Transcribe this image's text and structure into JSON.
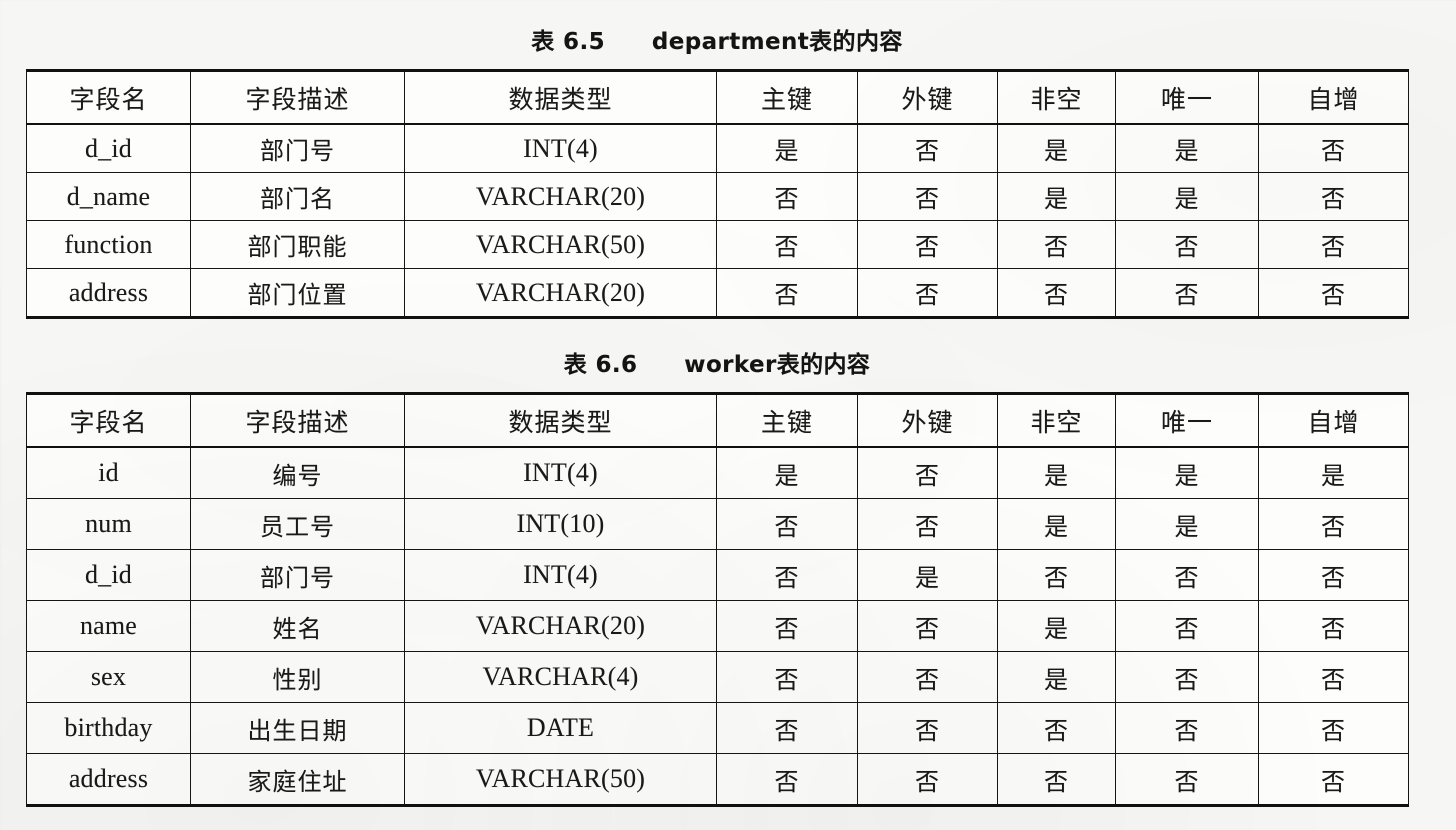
{
  "page": {
    "background_color": "#f6f6f4",
    "ink_color": "#161616"
  },
  "tables": [
    {
      "caption_number": "表 6.5",
      "caption_text": "department表的内容",
      "columns": [
        "字段名",
        "字段描述",
        "数据类型",
        "主键",
        "外键",
        "非空",
        "唯一",
        "自增"
      ],
      "rows": [
        [
          "d_id",
          "部门号",
          "INT(4)",
          "是",
          "否",
          "是",
          "是",
          "否"
        ],
        [
          "d_name",
          "部门名",
          "VARCHAR(20)",
          "否",
          "否",
          "是",
          "是",
          "否"
        ],
        [
          "function",
          "部门职能",
          "VARCHAR(50)",
          "否",
          "否",
          "否",
          "否",
          "否"
        ],
        [
          "address",
          "部门位置",
          "VARCHAR(20)",
          "否",
          "否",
          "否",
          "否",
          "否"
        ]
      ]
    },
    {
      "caption_number": "表 6.6",
      "caption_text": "worker表的内容",
      "columns": [
        "字段名",
        "字段描述",
        "数据类型",
        "主键",
        "外键",
        "非空",
        "唯一",
        "自增"
      ],
      "rows": [
        [
          "id",
          "编号",
          "INT(4)",
          "是",
          "否",
          "是",
          "是",
          "是"
        ],
        [
          "num",
          "员工号",
          "INT(10)",
          "否",
          "否",
          "是",
          "是",
          "否"
        ],
        [
          "d_id",
          "部门号",
          "INT(4)",
          "否",
          "是",
          "否",
          "否",
          "否"
        ],
        [
          "name",
          "姓名",
          "VARCHAR(20)",
          "否",
          "否",
          "是",
          "否",
          "否"
        ],
        [
          "sex",
          "性别",
          "VARCHAR(4)",
          "否",
          "否",
          "是",
          "否",
          "否"
        ],
        [
          "birthday",
          "出生日期",
          "DATE",
          "否",
          "否",
          "否",
          "否",
          "否"
        ],
        [
          "address",
          "家庭住址",
          "VARCHAR(50)",
          "否",
          "否",
          "否",
          "否",
          "否"
        ]
      ]
    }
  ]
}
